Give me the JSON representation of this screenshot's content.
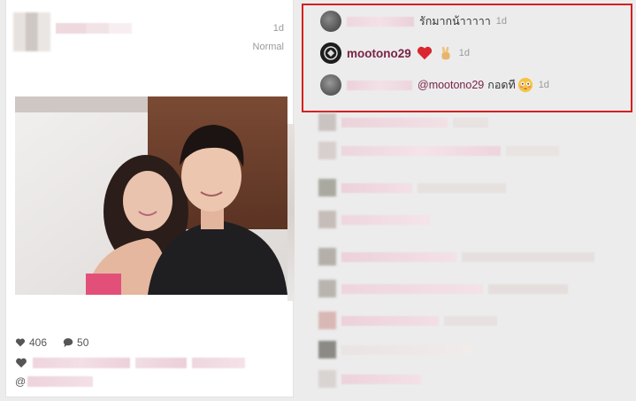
{
  "post": {
    "time": "1d",
    "filter": "Normal",
    "likes": "406",
    "comments_count": "50",
    "mention_prefix": "@"
  },
  "comments": [
    {
      "text": "รักมากน้าาาาา",
      "time": "1d"
    },
    {
      "user": "mootono29",
      "time": "1d"
    },
    {
      "mention": "@mootono29",
      "text": "กอดที",
      "time": "1d"
    }
  ],
  "colors": {
    "highlight_border": "#d32020",
    "username": "#7a2346",
    "muted_text": "#9a9a9a",
    "background": "#ececec"
  },
  "icons": {
    "likes": "heart-icon",
    "comments": "speech-bubble-icon",
    "reactions": [
      "red-heart-emoji",
      "victory-hand-emoji",
      "flushed-face-emoji"
    ]
  }
}
